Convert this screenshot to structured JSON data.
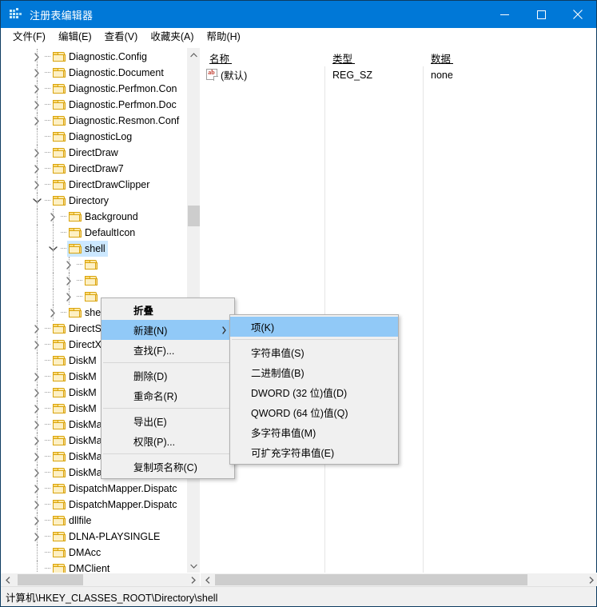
{
  "window": {
    "title": "注册表编辑器",
    "icon": "registry-icon",
    "controls": {
      "minimize": "minimize-icon",
      "maximize": "maximize-icon",
      "close": "close-icon"
    }
  },
  "menubar": {
    "items": [
      {
        "label": "文件(F)",
        "name": "menu-file"
      },
      {
        "label": "编辑(E)",
        "name": "menu-edit"
      },
      {
        "label": "查看(V)",
        "name": "menu-view"
      },
      {
        "label": "收藏夹(A)",
        "name": "menu-favorites"
      },
      {
        "label": "帮助(H)",
        "name": "menu-help"
      }
    ]
  },
  "tree": {
    "items": [
      {
        "label": "Diagnostic.Config",
        "depth": 1,
        "twisty": "collapsed",
        "selected": false
      },
      {
        "label": "Diagnostic.Document",
        "depth": 1,
        "twisty": "collapsed",
        "selected": false
      },
      {
        "label": "Diagnostic.Perfmon.Con",
        "depth": 1,
        "twisty": "collapsed",
        "selected": false
      },
      {
        "label": "Diagnostic.Perfmon.Doc",
        "depth": 1,
        "twisty": "collapsed",
        "selected": false
      },
      {
        "label": "Diagnostic.Resmon.Conf",
        "depth": 1,
        "twisty": "collapsed",
        "selected": false
      },
      {
        "label": "DiagnosticLog",
        "depth": 1,
        "twisty": "none",
        "selected": false
      },
      {
        "label": "DirectDraw",
        "depth": 1,
        "twisty": "collapsed",
        "selected": false
      },
      {
        "label": "DirectDraw7",
        "depth": 1,
        "twisty": "collapsed",
        "selected": false
      },
      {
        "label": "DirectDrawClipper",
        "depth": 1,
        "twisty": "collapsed",
        "selected": false
      },
      {
        "label": "Directory",
        "depth": 1,
        "twisty": "expanded",
        "selected": false
      },
      {
        "label": "Background",
        "depth": 2,
        "twisty": "collapsed",
        "selected": false
      },
      {
        "label": "DefaultIcon",
        "depth": 2,
        "twisty": "none",
        "selected": false
      },
      {
        "label": "shell",
        "depth": 2,
        "twisty": "expanded",
        "selected": true
      },
      {
        "label": "",
        "depth": 3,
        "twisty": "collapsed",
        "selected": false
      },
      {
        "label": "",
        "depth": 3,
        "twisty": "collapsed",
        "selected": false
      },
      {
        "label": "",
        "depth": 3,
        "twisty": "collapsed",
        "selected": false
      },
      {
        "label": "she",
        "depth": 2,
        "twisty": "collapsed",
        "selected": false
      },
      {
        "label": "DirectS",
        "depth": 1,
        "twisty": "collapsed",
        "selected": false
      },
      {
        "label": "DirectX",
        "depth": 1,
        "twisty": "collapsed",
        "selected": false
      },
      {
        "label": "DiskM",
        "depth": 1,
        "twisty": "none",
        "selected": false
      },
      {
        "label": "DiskM",
        "depth": 1,
        "twisty": "collapsed",
        "selected": false
      },
      {
        "label": "DiskM",
        "depth": 1,
        "twisty": "collapsed",
        "selected": false
      },
      {
        "label": "DiskM",
        "depth": 1,
        "twisty": "collapsed",
        "selected": false
      },
      {
        "label": "DiskManagement.Snapl",
        "depth": 1,
        "twisty": "collapsed",
        "selected": false
      },
      {
        "label": "DiskManagement.Snapl",
        "depth": 1,
        "twisty": "collapsed",
        "selected": false
      },
      {
        "label": "DiskManagement.Snapl",
        "depth": 1,
        "twisty": "collapsed",
        "selected": false
      },
      {
        "label": "DiskManagement.UITasl",
        "depth": 1,
        "twisty": "collapsed",
        "selected": false
      },
      {
        "label": "DispatchMapper.Dispatc",
        "depth": 1,
        "twisty": "collapsed",
        "selected": false
      },
      {
        "label": "DispatchMapper.Dispatc",
        "depth": 1,
        "twisty": "collapsed",
        "selected": false
      },
      {
        "label": "dllfile",
        "depth": 1,
        "twisty": "collapsed",
        "selected": false
      },
      {
        "label": "DLNA-PLAYSINGLE",
        "depth": 1,
        "twisty": "collapsed",
        "selected": false
      },
      {
        "label": "DMAcc",
        "depth": 1,
        "twisty": "none",
        "selected": false
      },
      {
        "label": "DMClient",
        "depth": 1,
        "twisty": "none",
        "selected": false
      }
    ]
  },
  "list": {
    "columns": [
      {
        "label": "名称",
        "name": "column-name"
      },
      {
        "label": "类型",
        "name": "column-type"
      },
      {
        "label": "数据",
        "name": "column-data"
      }
    ],
    "rows": [
      {
        "icon": "string-value-icon",
        "name": "(默认)",
        "type": "REG_SZ",
        "data": "none"
      }
    ]
  },
  "context_menu": {
    "items": [
      {
        "label": "折叠",
        "name": "ctx-collapse",
        "bold": true,
        "highlight": false,
        "submenu": false,
        "separator_after": false
      },
      {
        "label": "新建(N)",
        "name": "ctx-new",
        "bold": false,
        "highlight": true,
        "submenu": true,
        "separator_after": false
      },
      {
        "label": "查找(F)...",
        "name": "ctx-find",
        "bold": false,
        "highlight": false,
        "submenu": false,
        "separator_after": true
      },
      {
        "label": "删除(D)",
        "name": "ctx-delete",
        "bold": false,
        "highlight": false,
        "submenu": false,
        "separator_after": false
      },
      {
        "label": "重命名(R)",
        "name": "ctx-rename",
        "bold": false,
        "highlight": false,
        "submenu": false,
        "separator_after": true
      },
      {
        "label": "导出(E)",
        "name": "ctx-export",
        "bold": false,
        "highlight": false,
        "submenu": false,
        "separator_after": false
      },
      {
        "label": "权限(P)...",
        "name": "ctx-permissions",
        "bold": false,
        "highlight": false,
        "submenu": false,
        "separator_after": true
      },
      {
        "label": "复制项名称(C)",
        "name": "ctx-copy-key-name",
        "bold": false,
        "highlight": false,
        "submenu": false,
        "separator_after": false
      }
    ]
  },
  "submenu": {
    "items": [
      {
        "label": "项(K)",
        "name": "submenu-key",
        "highlight": true,
        "separator_after": true
      },
      {
        "label": "字符串值(S)",
        "name": "submenu-string-value",
        "highlight": false,
        "separator_after": false
      },
      {
        "label": "二进制值(B)",
        "name": "submenu-binary-value",
        "highlight": false,
        "separator_after": false
      },
      {
        "label": "DWORD (32 位)值(D)",
        "name": "submenu-dword-value",
        "highlight": false,
        "separator_after": false
      },
      {
        "label": "QWORD (64 位)值(Q)",
        "name": "submenu-qword-value",
        "highlight": false,
        "separator_after": false
      },
      {
        "label": "多字符串值(M)",
        "name": "submenu-multi-string",
        "highlight": false,
        "separator_after": false
      },
      {
        "label": "可扩充字符串值(E)",
        "name": "submenu-expandable",
        "highlight": false,
        "separator_after": false
      }
    ]
  },
  "statusbar": {
    "path": "计算机\\HKEY_CLASSES_ROOT\\Directory\\shell"
  },
  "colors": {
    "titlebar": "#0078d7",
    "selection": "#cce8ff",
    "menu_highlight": "#91c9f7",
    "folder": "#fdd970",
    "chrome": "#f0f0f0"
  }
}
